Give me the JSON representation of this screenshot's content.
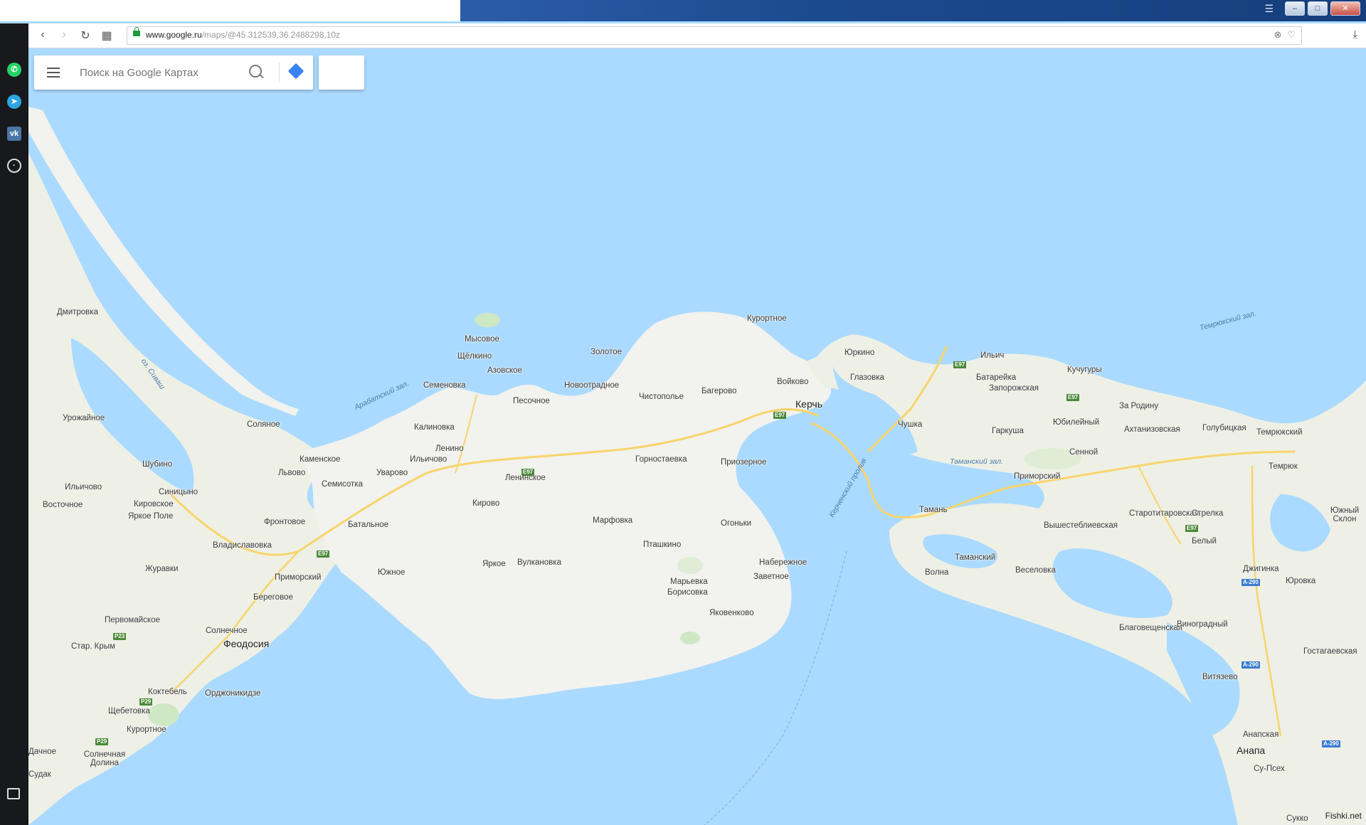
{
  "browser": {
    "url_host": "www.google.ru",
    "url_path": "/maps/@45.312539,36.2488298,10z"
  },
  "sidebar_icons": [
    "whatsapp-icon",
    "telegram-icon",
    "vk-icon",
    "clock-icon",
    "panel-icon"
  ],
  "search": {
    "placeholder": "Поиск на Google Картах"
  },
  "map": {
    "labels": [
      {
        "text": "Керчь",
        "big": true
      },
      {
        "text": "Феодосия",
        "big": true
      },
      {
        "text": "Анапа",
        "big": true
      },
      {
        "text": "Курортное"
      },
      {
        "text": "Юркино"
      },
      {
        "text": "Глазовка"
      },
      {
        "text": "Войково"
      },
      {
        "text": "Багерово"
      },
      {
        "text": "Золотое"
      },
      {
        "text": "Новоотрадное"
      },
      {
        "text": "Чистополье"
      },
      {
        "text": "Мысовое"
      },
      {
        "text": "Щёлкино"
      },
      {
        "text": "Азовское"
      },
      {
        "text": "Семеновка"
      },
      {
        "text": "Песочное"
      },
      {
        "text": "Калиновка"
      },
      {
        "text": "Ленино"
      },
      {
        "text": "Ильичово"
      },
      {
        "text": "Каменское"
      },
      {
        "text": "Львово"
      },
      {
        "text": "Семисотка"
      },
      {
        "text": "Уварово"
      },
      {
        "text": "Ленинское"
      },
      {
        "text": "Горностаевка"
      },
      {
        "text": "Приозерное"
      },
      {
        "text": "Кирово"
      },
      {
        "text": "Марфовка"
      },
      {
        "text": "Огоньки"
      },
      {
        "text": "Пташкино"
      },
      {
        "text": "Набережное"
      },
      {
        "text": "Заветное"
      },
      {
        "text": "Марьевка"
      },
      {
        "text": "Борисовка"
      },
      {
        "text": "Яковенково"
      },
      {
        "text": "Яркое"
      },
      {
        "text": "Вулкановка"
      },
      {
        "text": "Южное"
      },
      {
        "text": "Батальное"
      },
      {
        "text": "Фронтовое"
      },
      {
        "text": "Владиславовка"
      },
      {
        "text": "Приморский"
      },
      {
        "text": "Береговое"
      },
      {
        "text": "Солнечное"
      },
      {
        "text": "Орджоникидзе"
      },
      {
        "text": "Коктебель"
      },
      {
        "text": "Щебетовка"
      },
      {
        "text": "Курортное"
      },
      {
        "text": "Солнечная Долина"
      },
      {
        "text": "Дачное"
      },
      {
        "text": "Судак"
      },
      {
        "text": "Стар. Крым"
      },
      {
        "text": "Первомайское"
      },
      {
        "text": "Журавки"
      },
      {
        "text": "Яркое Поле"
      },
      {
        "text": "Кировское"
      },
      {
        "text": "Синицыно"
      },
      {
        "text": "Шубино"
      },
      {
        "text": "Ильичово"
      },
      {
        "text": "Восточное"
      },
      {
        "text": "Урожайное"
      },
      {
        "text": "Соляное"
      },
      {
        "text": "Дмитровка"
      },
      {
        "text": "Чушка"
      },
      {
        "text": "Ильич"
      },
      {
        "text": "Батарейка"
      },
      {
        "text": "Запорожская"
      },
      {
        "text": "Кучугуры"
      },
      {
        "text": "За Родину"
      },
      {
        "text": "Юбилейный"
      },
      {
        "text": "Гаркуша"
      },
      {
        "text": "Ахтанизовская"
      },
      {
        "text": "Голубицкая"
      },
      {
        "text": "Темрюкский"
      },
      {
        "text": "Темрюк"
      },
      {
        "text": "Сенной"
      },
      {
        "text": "Приморский"
      },
      {
        "text": "Тамань"
      },
      {
        "text": "Вышестеблиевская"
      },
      {
        "text": "Старотитаровская"
      },
      {
        "text": "Стрелка"
      },
      {
        "text": "Белый"
      },
      {
        "text": "Таманский"
      },
      {
        "text": "Веселовка"
      },
      {
        "text": "Волна"
      },
      {
        "text": "Джигинка"
      },
      {
        "text": "Юровка"
      },
      {
        "text": "Благовещенская"
      },
      {
        "text": "Виноградный"
      },
      {
        "text": "Витязево"
      },
      {
        "text": "Гостагаевская"
      },
      {
        "text": "Анапская"
      },
      {
        "text": "Су-Псех"
      },
      {
        "text": "Сукко"
      },
      {
        "text": "Южный Склон"
      }
    ],
    "water_labels": [
      "Темрюкский зал.",
      "Арабатский зал.",
      "оз. Сиваш",
      "Таманский зал.",
      "Керченский пролив"
    ],
    "road_labels": [
      "E97",
      "E97",
      "E97",
      "E97",
      "E97",
      "E97",
      "P23",
      "P29",
      "P29",
      "А-290",
      "А-290",
      "А-290"
    ]
  },
  "branding": {
    "google": "Google",
    "watermark": "Fishki.net"
  },
  "colors": {
    "water": "#aadaff",
    "land": "#f2f2ee",
    "green": "#cfe8c4",
    "road": "#f8d46a"
  }
}
